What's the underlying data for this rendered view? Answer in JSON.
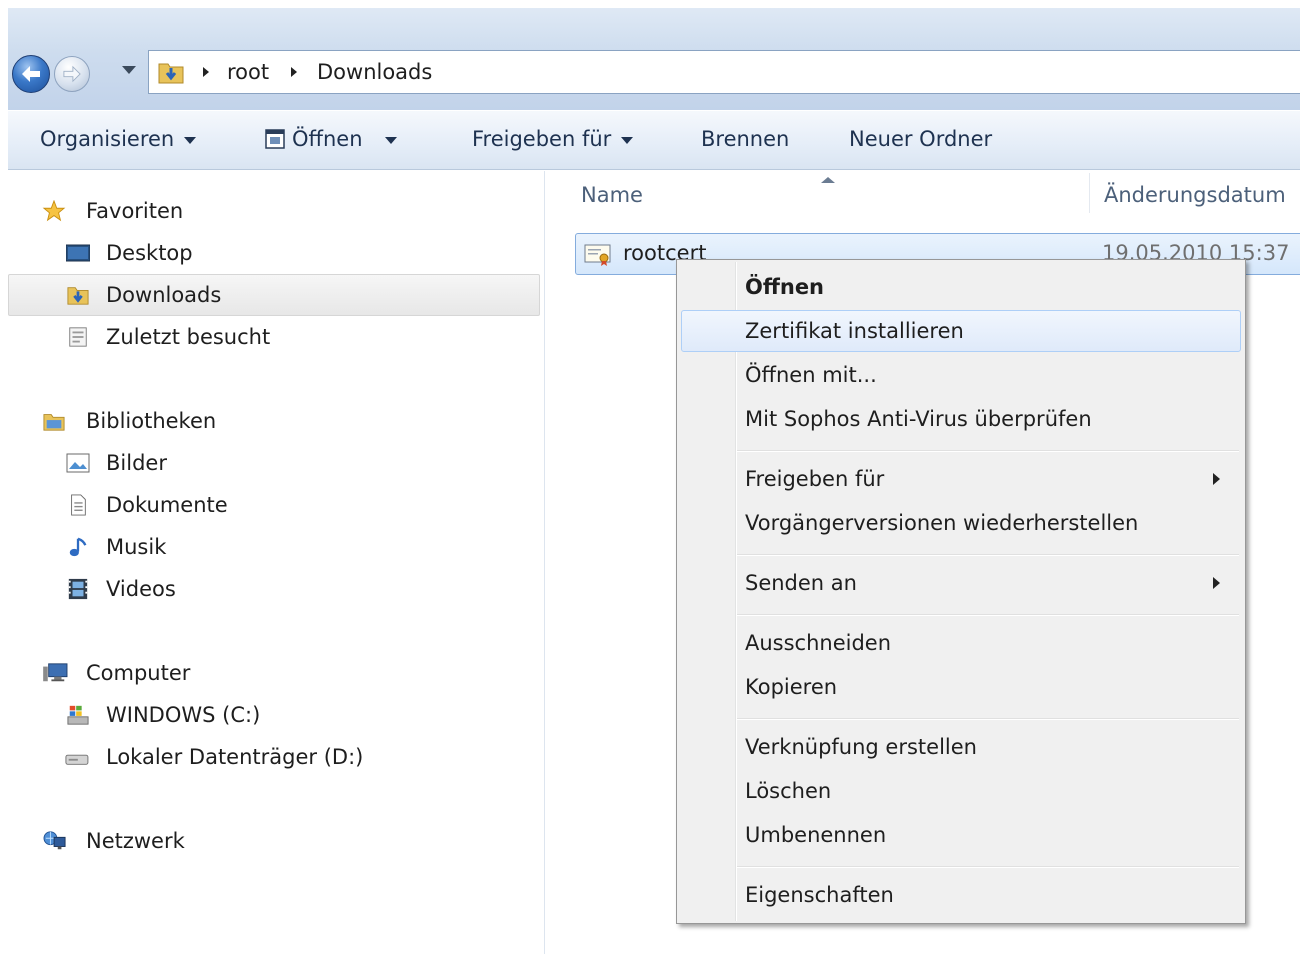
{
  "address": {
    "crumbs": [
      "root",
      "Downloads"
    ]
  },
  "toolbar": {
    "organize": "Organisieren",
    "open": "Öffnen",
    "share": "Freigeben für",
    "burn": "Brennen",
    "new_folder": "Neuer Ordner"
  },
  "navpane": {
    "favorites": "Favoriten",
    "desktop": "Desktop",
    "downloads": "Downloads",
    "recent": "Zuletzt besucht",
    "libraries": "Bibliotheken",
    "pictures": "Bilder",
    "documents": "Dokumente",
    "music": "Musik",
    "videos": "Videos",
    "computer": "Computer",
    "drive_c": "WINDOWS (C:)",
    "drive_d": "Lokaler Datenträger (D:)",
    "network": "Netzwerk"
  },
  "filelist": {
    "col_name": "Name",
    "col_date": "Änderungsdatum",
    "file": {
      "name": "rootcert",
      "date": "19.05.2010 15:37"
    }
  },
  "context_menu": {
    "open": "Öffnen",
    "install_cert": "Zertifikat installieren",
    "open_with": "Öffnen mit...",
    "sophos": "Mit Sophos Anti-Virus überprüfen",
    "share": "Freigeben für",
    "restore": "Vorgängerversionen wiederherstellen",
    "send_to": "Senden an",
    "cut": "Ausschneiden",
    "copy": "Kopieren",
    "shortcut": "Verknüpfung erstellen",
    "delete": "Löschen",
    "rename": "Umbenennen",
    "properties": "Eigenschaften"
  },
  "colors": {
    "accent": "#3a78c8",
    "selection": "#d5e7fb",
    "menu_bg": "#f0f0f0"
  }
}
